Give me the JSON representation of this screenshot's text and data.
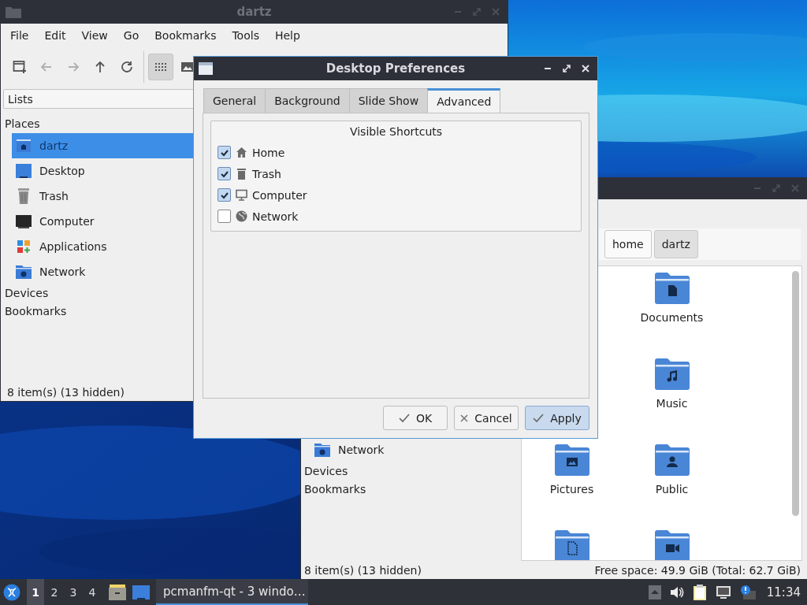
{
  "file_manager_1": {
    "title": "dartz",
    "menu": [
      "File",
      "Edit",
      "View",
      "Go",
      "Bookmarks",
      "Tools",
      "Help"
    ],
    "toolbar": [
      {
        "kind": "new-window",
        "disabled": false,
        "selected": false
      },
      {
        "kind": "back",
        "disabled": true,
        "selected": false
      },
      {
        "kind": "forward",
        "disabled": true,
        "selected": false
      },
      {
        "kind": "up",
        "disabled": false,
        "selected": false
      },
      {
        "kind": "reload",
        "disabled": false,
        "selected": false
      },
      {
        "kind": "icon-view",
        "disabled": false,
        "selected": true
      },
      {
        "kind": "thumbnail-view",
        "disabled": false,
        "selected": false
      }
    ],
    "side_pane": {
      "dropdown": "Lists",
      "places_label": "Places",
      "places": [
        {
          "label": "dartz",
          "kind": "home",
          "selected": true
        },
        {
          "label": "Desktop",
          "kind": "desktop",
          "selected": false
        },
        {
          "label": "Trash",
          "kind": "trash",
          "selected": false
        },
        {
          "label": "Computer",
          "kind": "computer",
          "selected": false
        },
        {
          "label": "Applications",
          "kind": "applications",
          "selected": false
        },
        {
          "label": "Network",
          "kind": "network",
          "selected": false
        }
      ],
      "sections": [
        "Devices",
        "Bookmarks"
      ]
    },
    "status": "8 item(s) (13 hidden)"
  },
  "file_manager_2": {
    "path_bar": [
      {
        "label": "home",
        "selected": false
      },
      {
        "label": "dartz",
        "selected": true
      }
    ],
    "side_pane": {
      "places": [
        {
          "label": "Network",
          "kind": "network",
          "selected": false
        }
      ],
      "sections": [
        "Devices",
        "Bookmarks"
      ]
    },
    "files": [
      {
        "label": "Documents",
        "kind": "documents"
      },
      {
        "label": "Music",
        "kind": "music"
      },
      {
        "label": "Pictures",
        "kind": "pictures"
      },
      {
        "label": "Public",
        "kind": "public"
      },
      {
        "kind": "templates"
      },
      {
        "kind": "videos"
      }
    ],
    "status": "8 item(s) (13 hidden)",
    "free_space": "Free space: 49.9 GiB (Total: 62.7 GiB)"
  },
  "dialog": {
    "title": "Desktop Preferences",
    "tabs": [
      {
        "label": "General",
        "selected": false
      },
      {
        "label": "Background",
        "selected": false
      },
      {
        "label": "Slide Show",
        "selected": false
      },
      {
        "label": "Advanced",
        "selected": true
      }
    ],
    "group_title": "Visible Shortcuts",
    "shortcuts": [
      {
        "label": "Home",
        "kind": "home",
        "checked": true
      },
      {
        "label": "Trash",
        "kind": "trash",
        "checked": true
      },
      {
        "label": "Computer",
        "kind": "computer",
        "checked": true
      },
      {
        "label": "Network",
        "kind": "network",
        "checked": false
      }
    ],
    "buttons": [
      {
        "label": "OK",
        "kind": "ok",
        "default": false
      },
      {
        "label": "Cancel",
        "kind": "cancel",
        "default": false
      },
      {
        "label": "Apply",
        "kind": "ok",
        "default": true
      }
    ]
  },
  "taskbar": {
    "workspaces": [
      {
        "label": "1",
        "selected": true
      },
      {
        "label": "2",
        "selected": false
      },
      {
        "label": "3",
        "selected": false
      },
      {
        "label": "4",
        "selected": false
      }
    ],
    "launchers": [
      {
        "kind": "file-manager"
      },
      {
        "kind": "desktop"
      }
    ],
    "tasks": [
      {
        "label": "pcmanfm-qt - 3 windo…",
        "selected": true
      }
    ],
    "tray": [
      {
        "kind": "expand"
      },
      {
        "kind": "volume"
      },
      {
        "kind": "clipboard"
      },
      {
        "kind": "network"
      },
      {
        "kind": "notification"
      }
    ],
    "clock": "11:34"
  }
}
